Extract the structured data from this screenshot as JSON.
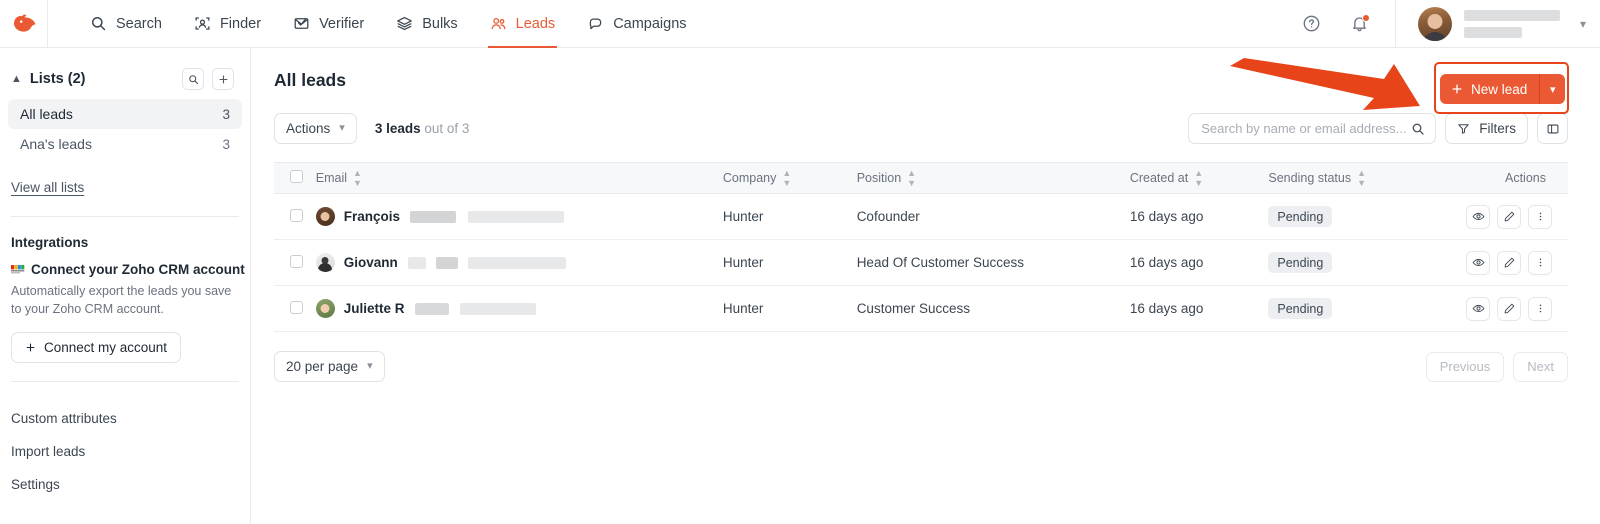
{
  "brand": {
    "accent": "#ea5933",
    "highlight": "#e8441a",
    "logo_icon": "hunter-fox-logo"
  },
  "topnav": {
    "items": [
      {
        "label": "Search",
        "icon": "search-icon",
        "active": false
      },
      {
        "label": "Finder",
        "icon": "person-scan-icon",
        "active": false
      },
      {
        "label": "Verifier",
        "icon": "envelope-check-icon",
        "active": false
      },
      {
        "label": "Bulks",
        "icon": "layers-icon",
        "active": false
      },
      {
        "label": "Leads",
        "icon": "people-icon",
        "active": true
      },
      {
        "label": "Campaigns",
        "icon": "megaphone-icon",
        "active": false
      }
    ],
    "help_icon": "question-circle-icon",
    "notifications_icon": "bell-icon",
    "notifications_badge": true,
    "user_name": "",
    "user_email": "",
    "user_chevron": "chevron-down-icon"
  },
  "sidebar": {
    "lists_header": "Lists (2)",
    "collapse_icon": "chevron-up-icon",
    "search_icon": "search-icon",
    "add_icon": "plus-icon",
    "lists": [
      {
        "label": "All leads",
        "count": "3",
        "active": true
      },
      {
        "label": "Ana's leads",
        "count": "3",
        "active": false
      }
    ],
    "view_all_label": "View all lists",
    "integrations_title": "Integrations",
    "integration": {
      "icon": "zoho-crm-icon",
      "title": "Connect your Zoho CRM account",
      "description": "Automatically export the leads you save to your Zoho CRM account.",
      "button_label": "Connect my account",
      "button_icon": "plus-icon"
    },
    "links": [
      {
        "label": "Custom attributes"
      },
      {
        "label": "Import leads"
      },
      {
        "label": "Settings"
      }
    ]
  },
  "main": {
    "title": "All leads",
    "actions_button": "Actions",
    "count_prefix": "3 leads",
    "count_suffix": "out of 3",
    "search_placeholder": "Search by name or email address...",
    "search_value": "",
    "filters_label": "Filters",
    "filters_icon": "funnel-icon",
    "columns_icon": "columns-layout-icon",
    "new_lead_label": "New lead",
    "new_lead_icon": "plus-icon",
    "new_lead_caret": "chevron-down-icon",
    "highlight_arrow": "pointer-arrow-annotation"
  },
  "table": {
    "columns": [
      {
        "label": "Email",
        "sortable": true
      },
      {
        "label": "Company",
        "sortable": true
      },
      {
        "label": "Position",
        "sortable": true
      },
      {
        "label": "Created at",
        "sortable": true
      },
      {
        "label": "Sending status",
        "sortable": true
      },
      {
        "label": "Actions",
        "sortable": false
      }
    ],
    "rows": [
      {
        "avatar": "avatar-francois",
        "name": "François",
        "name_redacted": true,
        "company": "Hunter",
        "position": "Cofounder",
        "created_at": "16 days ago",
        "status": "Pending"
      },
      {
        "avatar": "avatar-giovann",
        "name": "Giovann",
        "name_redacted": true,
        "company": "Hunter",
        "position": "Head Of Customer Success",
        "created_at": "16 days ago",
        "status": "Pending"
      },
      {
        "avatar": "avatar-juliette",
        "name": "Juliette R",
        "name_redacted": true,
        "company": "Hunter",
        "position": "Customer Success",
        "created_at": "16 days ago",
        "status": "Pending"
      }
    ],
    "row_actions": [
      {
        "icon": "eye-icon"
      },
      {
        "icon": "pencil-icon"
      },
      {
        "icon": "more-vertical-icon"
      }
    ]
  },
  "footer": {
    "per_page_label": "20 per page",
    "per_page_caret": "chevron-down-icon",
    "previous_label": "Previous",
    "next_label": "Next"
  }
}
